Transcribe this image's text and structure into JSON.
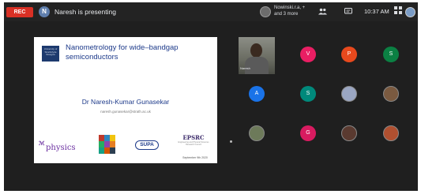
{
  "topbar": {
    "recording_badge": "REC",
    "presenter_initial": "N",
    "presenting_text": "Naresh is presenting",
    "others_text": "Nowinski.r.a, +\nand 3 more",
    "time": "10:37 AM"
  },
  "slide": {
    "logo_text": "University of Strathclyde Glasgow",
    "title": "Nanometrology for wide–bandgap semiconductors",
    "author": "Dr Naresh-Kumar Gunasekar",
    "email": "naresh.gunasekar@strath.ac.uk",
    "logo_physics_prefix": "ℳ",
    "logo_physics_word": "physics",
    "logo_supa": "SUPA",
    "logo_epsrc": "EPSRC",
    "logo_epsrc_sub": "Engineering and Physical Sciences Research Council",
    "date": "September 9th 2020"
  },
  "participants": [
    {
      "type": "video",
      "name": "Naresh"
    },
    {
      "type": "initial",
      "letter": "V",
      "color": "#e91e63"
    },
    {
      "type": "initial",
      "letter": "P",
      "color": "#e8491d"
    },
    {
      "type": "initial",
      "letter": "S",
      "color": "#0b8043"
    },
    {
      "type": "initial",
      "letter": "A",
      "color": "#1a73e8"
    },
    {
      "type": "initial",
      "letter": "S",
      "color": "#00897b"
    },
    {
      "type": "photo",
      "color": "#9aa6c2"
    },
    {
      "type": "photo",
      "color": "#7a5a40"
    },
    {
      "type": "photo",
      "color": "#6d7a5a"
    },
    {
      "type": "initial",
      "letter": "G",
      "color": "#d81b60"
    },
    {
      "type": "photo",
      "color": "#5a3a30"
    },
    {
      "type": "photo",
      "color": "#b05030"
    }
  ]
}
